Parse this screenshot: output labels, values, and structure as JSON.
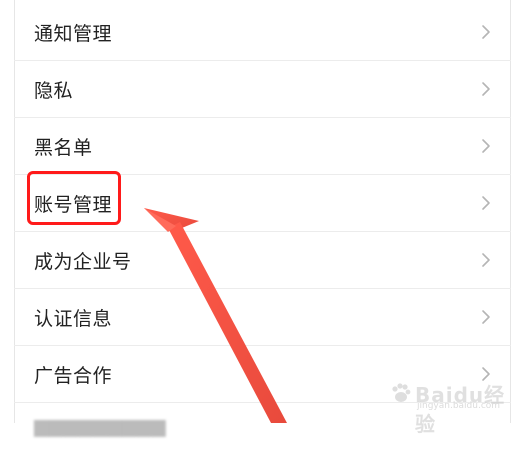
{
  "menu": {
    "items": [
      {
        "label": "通知管理"
      },
      {
        "label": "隐私"
      },
      {
        "label": "黑名单"
      },
      {
        "label": "账号管理"
      },
      {
        "label": "成为企业号"
      },
      {
        "label": "认证信息"
      },
      {
        "label": "广告合作"
      }
    ]
  },
  "annotation": {
    "highlight_color": "#ff1a1a",
    "arrow_color": "#f05a4b"
  },
  "watermark": {
    "text": "Baidu经验",
    "sub": "jingyan.baidu.com"
  }
}
